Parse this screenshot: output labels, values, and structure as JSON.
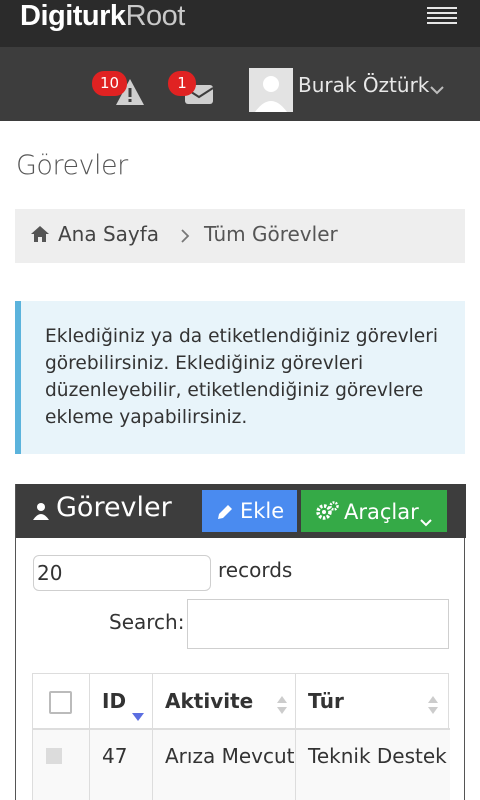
{
  "header": {
    "logo_text": "DigiturkRoot",
    "logo_brand": "Digiturk",
    "logo_suffix": "Root",
    "menu_icon": "hamburger-menu-icon"
  },
  "userbar": {
    "alerts_count": "10",
    "messages_count": "1",
    "alert_icon": "warning-icon",
    "message_icon": "envelope-icon",
    "user_name": "Burak Öztürk",
    "badge_color": "#e02222"
  },
  "page": {
    "title": "Görevler"
  },
  "breadcrumb": {
    "home": "Ana Sayfa",
    "current": "Tüm Görevler"
  },
  "note": {
    "text": "Eklediğiniz ya da etiketlendiğiniz görevleri görebilirsiniz. Eklediğiniz görevleri düzenleyebilir, etiketlendiğiniz görevlere ekleme yapabilirsiniz."
  },
  "portlet": {
    "title": "Görevler",
    "add_label": "Ekle",
    "tools_label": "Araçlar",
    "add_color": "#4a8bf0",
    "tools_color": "#35aa47"
  },
  "table_controls": {
    "page_size": "20",
    "records_label": "records",
    "search_label": "Search:",
    "search_value": ""
  },
  "table": {
    "columns": [
      "ID",
      "Aktivite",
      "Tür"
    ],
    "rows": [
      {
        "id": "47",
        "aktivite": "Arıza Mevcut",
        "tur": "Teknik Destek"
      }
    ]
  }
}
